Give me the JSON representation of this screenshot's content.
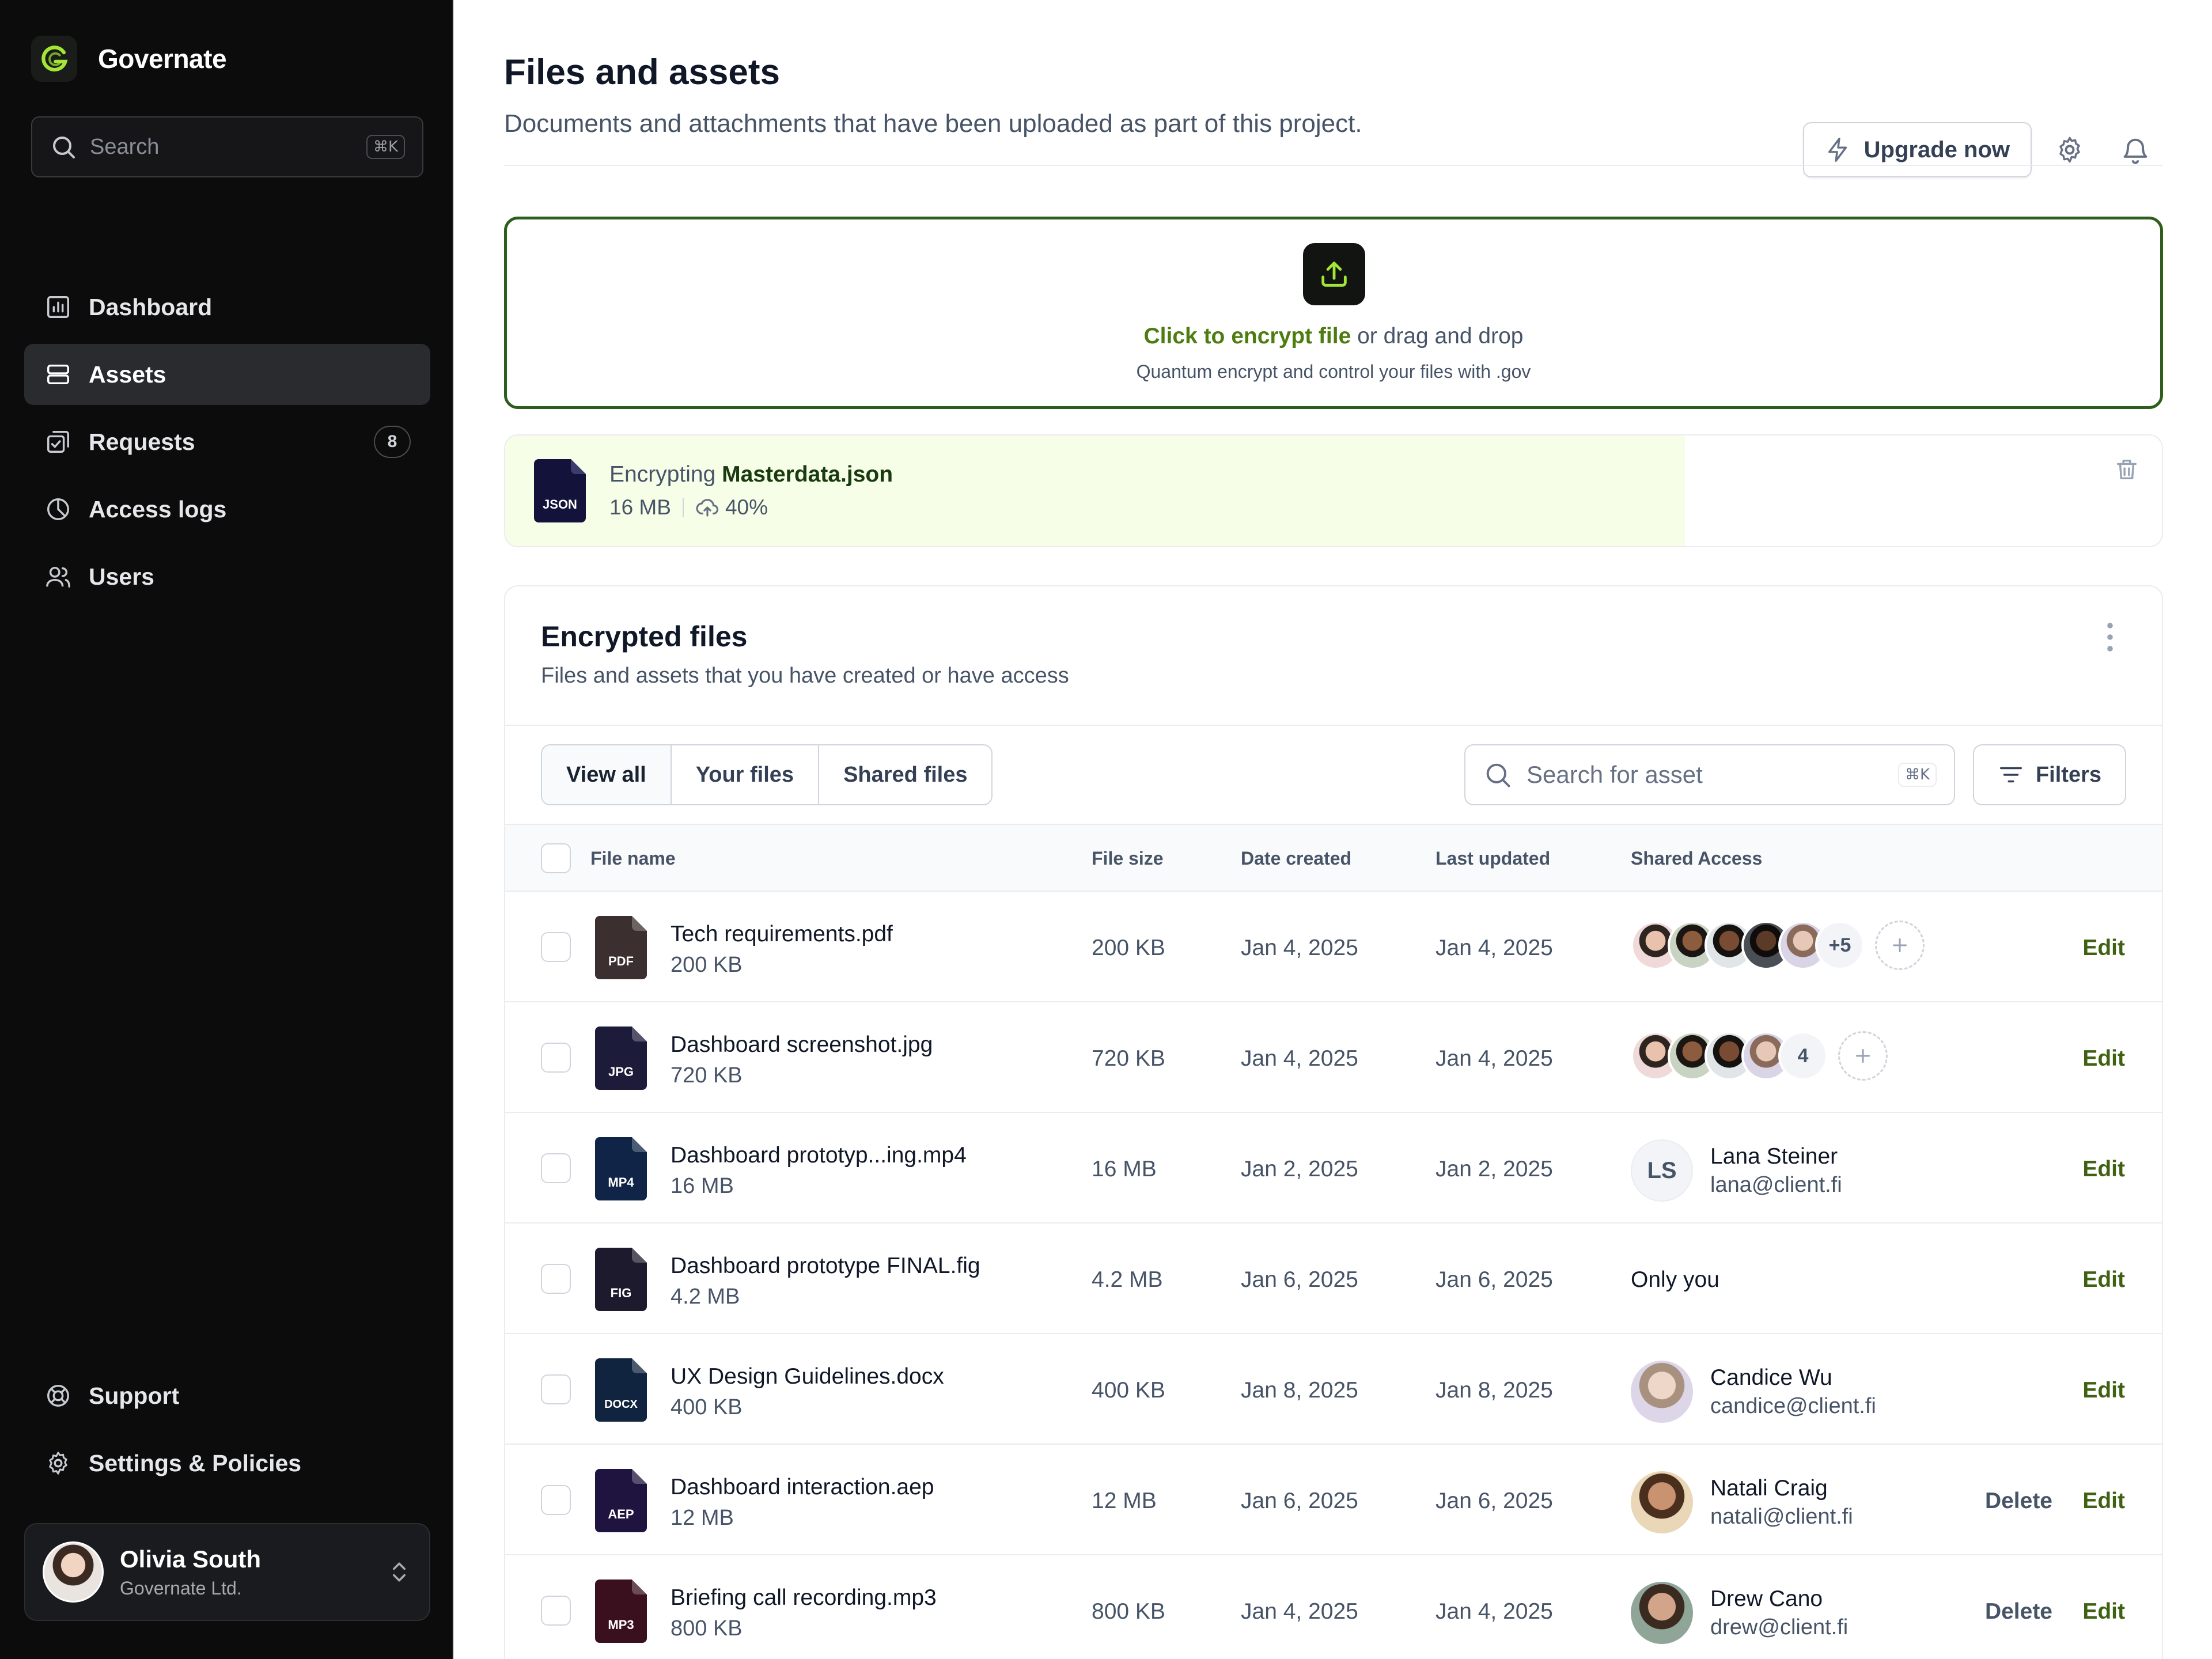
{
  "app": {
    "name": "Governate"
  },
  "sidebar": {
    "search_placeholder": "Search",
    "search_shortcut": "⌘K",
    "nav": [
      {
        "label": "Dashboard",
        "icon": "bar-chart-icon"
      },
      {
        "label": "Assets",
        "icon": "layers-icon",
        "active": true
      },
      {
        "label": "Requests",
        "icon": "check-square-icon",
        "badge": "8"
      },
      {
        "label": "Access logs",
        "icon": "pie-chart-icon"
      },
      {
        "label": "Users",
        "icon": "users-icon"
      }
    ],
    "bottom_nav": [
      {
        "label": "Support",
        "icon": "life-buoy-icon"
      },
      {
        "label": "Settings & Policies",
        "icon": "gear-icon"
      }
    ],
    "user": {
      "name": "Olivia South",
      "org": "Governate Ltd."
    }
  },
  "header": {
    "title": "Files and assets",
    "subtitle": "Documents and attachments that have been uploaded as part of this project.",
    "upgrade_label": "Upgrade now"
  },
  "dropzone": {
    "link": "Click to encrypt file",
    "rest": " or drag and drop",
    "hint": "Quantum encrypt and control your files with .gov"
  },
  "upload": {
    "prefix": "Encrypting ",
    "filename": "Masterdata.json",
    "file_type": "JSON",
    "size": "16 MB",
    "progress_label": "40%",
    "progress": 0.4
  },
  "files_card": {
    "title": "Encrypted files",
    "subtitle": "Files and assets that you have created or have access",
    "tabs": [
      "View all",
      "Your files",
      "Shared files"
    ],
    "search_placeholder": "Search for asset",
    "search_shortcut": "⌘K",
    "filters_label": "Filters",
    "columns": [
      "File name",
      "File size",
      "Date created",
      "Last updated",
      "Shared Access"
    ],
    "rows": [
      {
        "type": "PDF",
        "type_color": "#3b2f2f",
        "name": "Tech requirements.pdf",
        "size": "200 KB",
        "created": "Jan 4, 2025",
        "updated": "Jan 4, 2025",
        "more": "+5",
        "edit": "Edit"
      },
      {
        "type": "JPG",
        "type_color": "#1d1b3a",
        "name": "Dashboard screenshot.jpg",
        "size": "720 KB",
        "created": "Jan 4, 2025",
        "updated": "Jan 4, 2025",
        "more": "4",
        "edit": "Edit"
      },
      {
        "type": "MP4",
        "type_color": "#0f2447",
        "name": "Dashboard prototyp...ing.mp4",
        "size": "16 MB",
        "created": "Jan 2, 2025",
        "updated": "Jan 2, 2025",
        "initials": "LS",
        "person": "Lana Steiner",
        "email": "lana@client.fi",
        "edit": "Edit"
      },
      {
        "type": "FIG",
        "type_color": "#1e1a2e",
        "name": "Dashboard prototype FINAL.fig",
        "size": "4.2 MB",
        "created": "Jan 6, 2025",
        "updated": "Jan 6, 2025",
        "only": "Only you",
        "edit": "Edit"
      },
      {
        "type": "DOCX",
        "type_color": "#10233f",
        "name": "UX Design Guidelines.docx",
        "size": "400 KB",
        "created": "Jan 8, 2025",
        "updated": "Jan 8, 2025",
        "person": "Candice Wu",
        "email": "candice@client.fi",
        "edit": "Edit"
      },
      {
        "type": "AEP",
        "type_color": "#1f1440",
        "name": "Dashboard interaction.aep",
        "size": "12 MB",
        "created": "Jan 6, 2025",
        "updated": "Jan 6, 2025",
        "person": "Natali Craig",
        "email": "natali@client.fi",
        "delete": "Delete",
        "edit": "Edit"
      },
      {
        "type": "MP3",
        "type_color": "#3a0f1e",
        "name": "Briefing call recording.mp3",
        "size": "800 KB",
        "created": "Jan 4, 2025",
        "updated": "Jan 4, 2025",
        "person": "Drew Cano",
        "email": "drew@client.fi",
        "delete": "Delete",
        "edit": "Edit"
      }
    ]
  }
}
